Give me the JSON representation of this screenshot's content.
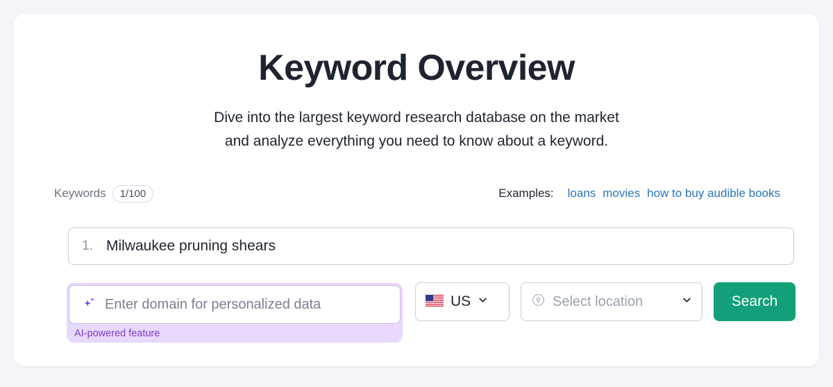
{
  "page": {
    "title": "Keyword Overview",
    "subtitle_line1": "Dive into the largest keyword research database on the market",
    "subtitle_line2": "and analyze everything you need to know about a keyword."
  },
  "meta": {
    "keywords_label": "Keywords",
    "keywords_count": "1/100",
    "examples_label": "Examples:",
    "examples": [
      {
        "text": "loans"
      },
      {
        "text": "movies"
      },
      {
        "text": "how to buy audible books"
      }
    ]
  },
  "keyword_input": {
    "index": "1.",
    "value": "Milwaukee pruning shears"
  },
  "domain_field": {
    "placeholder": "Enter domain for personalized data",
    "value": "",
    "ai_note": "AI-powered feature",
    "icon": "sparkle-icon"
  },
  "country_select": {
    "flag": "🇺🇸",
    "code": "US",
    "chevron": "chevron-down-icon"
  },
  "location_select": {
    "placeholder": "Select location",
    "value": "",
    "icon": "map-pin-icon",
    "chevron": "chevron-down-icon"
  },
  "search_button": {
    "label": "Search"
  },
  "colors": {
    "page_background": "#f4f5f9",
    "card_background": "#ffffff",
    "text_primary": "#1e2330",
    "text_muted": "#6c7283",
    "link_blue": "#2a75bb",
    "accent_green": "#13a078",
    "ai_purple": "#7a3dd0",
    "ai_purple_bg": "#e8d9fc",
    "border_gray": "#c8ccd7"
  }
}
